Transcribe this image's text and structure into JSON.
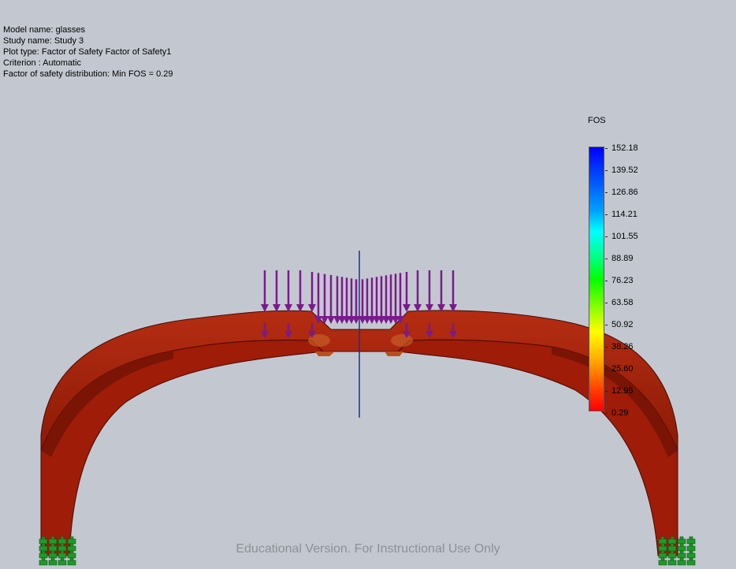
{
  "info": {
    "model_name": "Model name: glasses",
    "study_name": "Study name: Study 3",
    "plot_type": "Plot type: Factor of Safety Factor of Safety1",
    "criterion": "Criterion : Automatic",
    "distribution": "Factor of safety distribution: Min FOS = 0.29"
  },
  "legend": {
    "title": "FOS",
    "ticks": [
      "152.18",
      "139.52",
      "126.86",
      "114.21",
      "101.55",
      "88.89",
      "76.23",
      "63.58",
      "50.92",
      "38.26",
      "25.60",
      "12.95",
      "0.29"
    ]
  },
  "watermark": "Educational Version. For Instructional Use Only",
  "colors": {
    "background": "#c3c8d0",
    "frame": "#9e1c08",
    "load_arrows": "#7a1a8c",
    "fixtures": "#1f9a2a"
  },
  "icons": {
    "load_arrows": "down-arrow-icon",
    "fixtures": "fixture-anchor-icon"
  }
}
